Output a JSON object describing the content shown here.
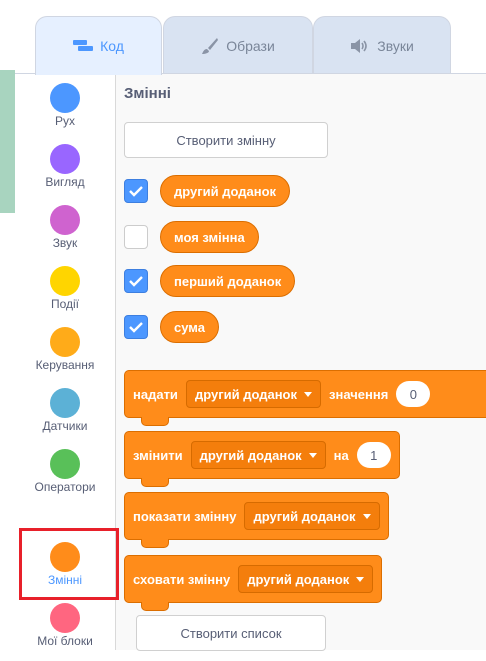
{
  "tabs": [
    {
      "label": "Код",
      "icon": "code-icon",
      "active": true
    },
    {
      "label": "Образи",
      "icon": "brush-icon",
      "active": false
    },
    {
      "label": "Звуки",
      "icon": "speaker-icon",
      "active": false
    }
  ],
  "categories": [
    {
      "label": "Рух",
      "color": "#4c97ff"
    },
    {
      "label": "Вигляд",
      "color": "#9966ff"
    },
    {
      "label": "Звук",
      "color": "#cf63cf"
    },
    {
      "label": "Події",
      "color": "#ffd500"
    },
    {
      "label": "Керування",
      "color": "#ffab19"
    },
    {
      "label": "Датчики",
      "color": "#5cb1d6"
    },
    {
      "label": "Оператори",
      "color": "#59c059"
    },
    {
      "label": "Змінні",
      "color": "#ff8c1a",
      "selected": true
    },
    {
      "label": "Мої блоки",
      "color": "#ff6680"
    }
  ],
  "palette": {
    "title": "Змінні",
    "make_variable": "Створити змінну",
    "variables": [
      {
        "name": "другий доданок",
        "checked": true
      },
      {
        "name": "моя змінна",
        "checked": false
      },
      {
        "name": "перший доданок",
        "checked": true
      },
      {
        "name": "сума",
        "checked": true
      }
    ],
    "blocks": {
      "set": {
        "text": "надати",
        "var": "другий доданок",
        "suffix": "значення",
        "value": "0"
      },
      "change": {
        "text": "змінити",
        "var": "другий доданок",
        "suffix": "на",
        "value": "1"
      },
      "show": {
        "text": "показати змінну",
        "var": "другий доданок"
      },
      "hide": {
        "text": "сховати змінну",
        "var": "другий доданок"
      }
    },
    "make_list": "Створити список"
  }
}
